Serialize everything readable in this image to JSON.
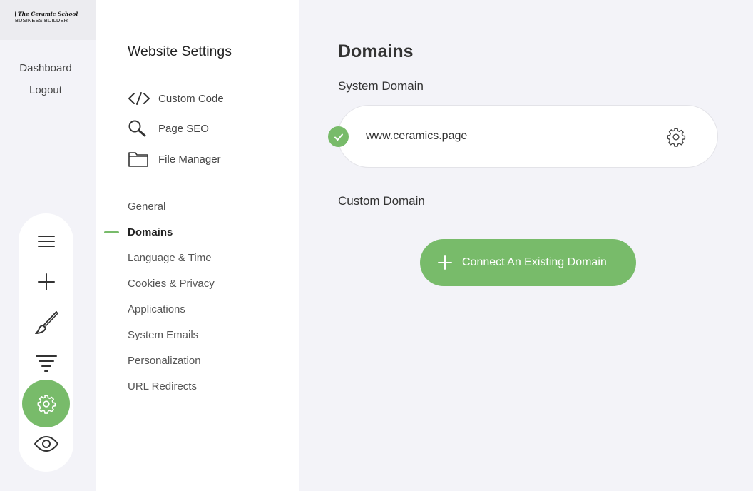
{
  "brand": {
    "logo_line1": "The Ceramic School",
    "logo_line2": "BUSINESS BUILDER"
  },
  "account_nav": {
    "dashboard": "Dashboard",
    "logout": "Logout"
  },
  "toolbar": {
    "items": [
      {
        "icon": "hamburger-menu-icon"
      },
      {
        "icon": "plus-icon"
      },
      {
        "icon": "brush-icon"
      },
      {
        "icon": "filter-icon"
      },
      {
        "icon": "gear-icon",
        "active": true
      },
      {
        "icon": "eye-icon"
      }
    ]
  },
  "settings_panel": {
    "title": "Website Settings",
    "tools": [
      {
        "label": "Custom Code",
        "icon": "code-icon"
      },
      {
        "label": "Page SEO",
        "icon": "search-icon"
      },
      {
        "label": "File Manager",
        "icon": "folder-icon"
      }
    ],
    "nav": [
      {
        "label": "General"
      },
      {
        "label": "Domains",
        "active": true
      },
      {
        "label": "Language & Time"
      },
      {
        "label": "Cookies & Privacy"
      },
      {
        "label": "Applications"
      },
      {
        "label": "System Emails"
      },
      {
        "label": "Personalization"
      },
      {
        "label": "URL Redirects"
      }
    ]
  },
  "main": {
    "title": "Domains",
    "system_domain": {
      "label": "System Domain",
      "domain": "www.ceramics.page",
      "status": "verified"
    },
    "custom_domain": {
      "label": "Custom Domain",
      "connect_button": "Connect An Existing Domain"
    }
  },
  "colors": {
    "accent": "#78bb6a",
    "background": "#f3f3f8",
    "panel": "#ffffff"
  }
}
